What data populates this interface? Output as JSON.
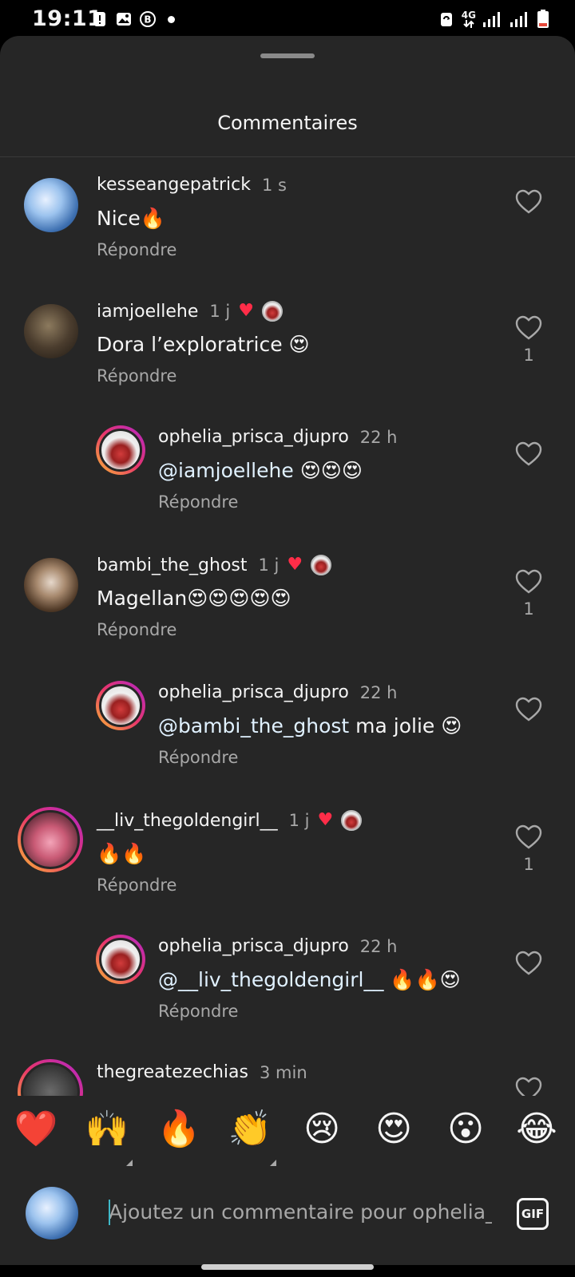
{
  "status_bar": {
    "time": "19:11",
    "network": "4G"
  },
  "sheet": {
    "title": "Commentaires"
  },
  "comments": [
    {
      "username": "kesseangepatrick",
      "time": "1 s",
      "text": "Nice🔥",
      "reply_label": "Répondre",
      "liked_by_creator": false,
      "like_count": ""
    },
    {
      "username": "iamjoellehe",
      "time": "1 j",
      "text": "Dora l’exploratrice 😍",
      "reply_label": "Répondre",
      "liked_by_creator": true,
      "like_count": "1"
    },
    {
      "username": "ophelia_prisca_djupro",
      "time": "22 h",
      "mention": "@iamjoellehe",
      "text": " 😍😍😍",
      "reply_label": "Répondre",
      "liked_by_creator": false,
      "like_count": ""
    },
    {
      "username": "bambi_the_ghost",
      "time": "1 j",
      "text": "Magellan😍😍😍😍😍",
      "reply_label": "Répondre",
      "liked_by_creator": true,
      "like_count": "1"
    },
    {
      "username": "ophelia_prisca_djupro",
      "time": "22 h",
      "mention": "@bambi_the_ghost",
      "text": "  ma jolie 😍",
      "reply_label": "Répondre",
      "liked_by_creator": false,
      "like_count": ""
    },
    {
      "username": "__liv_thegoldengirl__",
      "time": "1 j",
      "text": "🔥🔥",
      "reply_label": "Répondre",
      "liked_by_creator": true,
      "like_count": "1"
    },
    {
      "username": "ophelia_prisca_djupro",
      "time": "22 h",
      "mention": "@__liv_thegoldengirl__",
      "text": " 🔥🔥😍",
      "reply_label": "Répondre",
      "liked_by_creator": false,
      "like_count": ""
    },
    {
      "username": "thegreatezechias",
      "time": "3 min",
      "text": "",
      "reply_label": "",
      "liked_by_creator": false,
      "like_count": ""
    }
  ],
  "quick_reactions": [
    "❤️",
    "🙌",
    "🔥",
    "👏",
    "😢",
    "😍",
    "😮",
    "😂"
  ],
  "composer": {
    "placeholder": "Ajoutez un commentaire pour ophelia_pri",
    "gif_label": "GIF"
  },
  "colors": {
    "sheet_bg": "#262626",
    "secondary_text": "#a8a8a8",
    "creator_heart": "#ff2d48",
    "mention": "#e0f1ff"
  }
}
